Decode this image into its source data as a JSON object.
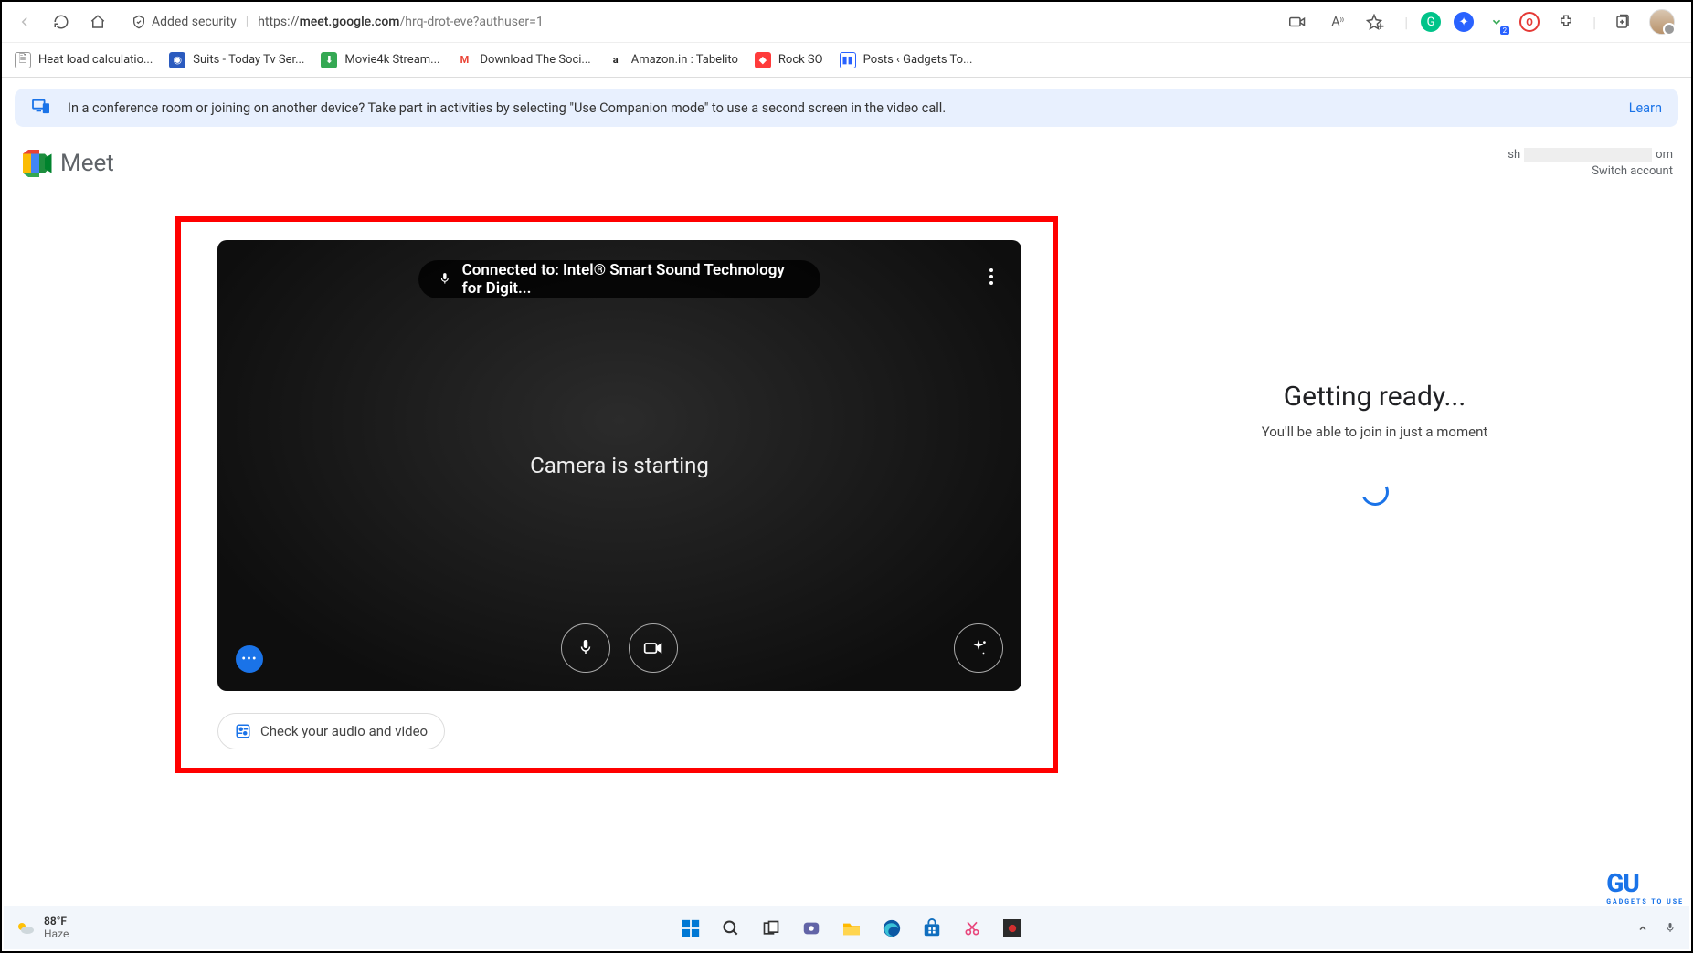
{
  "browser": {
    "security_label": "Added security",
    "url_host": "meet.google.com",
    "url_path": "/hrq-drot-eve?authuser=1"
  },
  "bookmarks": [
    {
      "label": "Heat load calculatio...",
      "color": "#888"
    },
    {
      "label": "Suits - Today Tv Ser...",
      "color": "#2b5bbf"
    },
    {
      "label": "Movie4k Stream...",
      "color": "#34a853"
    },
    {
      "label": "Download The Soci...",
      "color": "#ea4335"
    },
    {
      "label": "Amazon.in : Tabelito",
      "color": "#222"
    },
    {
      "label": "Rock SO",
      "color": "#ff3b3b"
    },
    {
      "label": "Posts ‹ Gadgets To...",
      "color": "#2962ff"
    }
  ],
  "banner": {
    "text": "In a conference room or joining on another device? Take part in activities by selecting \"Use Companion mode\" to use a second screen in the video call.",
    "learn": "Learn"
  },
  "meet": {
    "brand": "Meet",
    "account_prefix": "sh",
    "account_suffix": "om",
    "switch_label": "Switch account"
  },
  "preview": {
    "mic_status": "Connected to: Intel® Smart Sound Technology for Digit...",
    "camera_text": "Camera is starting",
    "check_label": "Check your audio and video"
  },
  "ready": {
    "title": "Getting ready...",
    "subtitle": "You'll be able to join in just a moment"
  },
  "taskbar": {
    "temp": "88°F",
    "condition": "Haze"
  },
  "watermark": {
    "text": "GU",
    "sub": "GADGETS TO USE"
  }
}
